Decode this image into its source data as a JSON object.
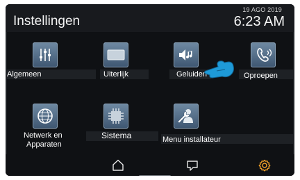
{
  "header": {
    "title": "Instellingen",
    "date": "19 AGO 2019",
    "time": "6:23 AM"
  },
  "menu": {
    "algemeen": "Algemeen",
    "uiterlijk": "Uiterlijk",
    "geluiden": "Geluiden",
    "oproepen": "Oproepen",
    "netwerk_line1": "Netwerk en",
    "netwerk_line2": "Apparaten",
    "sistema": "Sistema",
    "menu_installateur": "Menu installateur"
  },
  "icons": {
    "algemeen": "sliders-icon",
    "uiterlijk": "display-icon",
    "geluiden": "speaker-music-icon",
    "oproepen": "call-icon",
    "netwerk": "network-globe-icon",
    "sistema": "chip-icon",
    "installateur": "wrench-person-icon",
    "pointer": "pointing-hand-icon",
    "nav_home": "home-icon",
    "nav_messages": "message-icon",
    "nav_settings": "gear-icon"
  },
  "colors": {
    "accent_settings": "#f0a028",
    "tile": "#5b7591",
    "pointer": "#1e9ad8"
  }
}
